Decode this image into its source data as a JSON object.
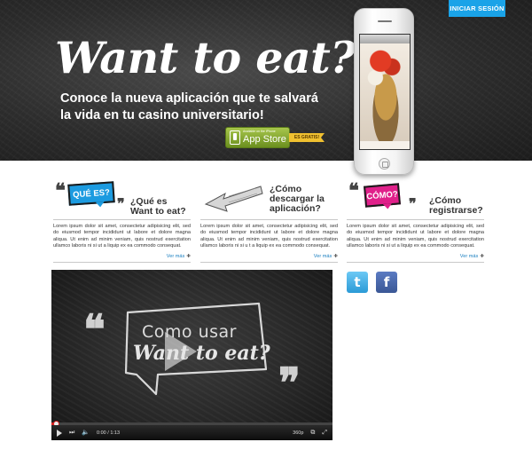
{
  "header": {
    "login_label": "INICIAR SESIÓN",
    "title": "Want to eat?",
    "subtitle": "Conoce la nueva aplicación que te salvará la vida en tu casino universitario!",
    "appstore": {
      "small_text": "Available on the iPhone",
      "big_text": "App Store"
    },
    "free_tag": "ES GRATIS!"
  },
  "features": [
    {
      "bubble": "QUÉ ES?",
      "title": "¿Qué es\nWant to eat?",
      "text": "Lorem ipsum dolor sit amet, consectetur adipisicing elit, sed do eiusmod tempor incididunt ut labore et dolore magna aliqua. Ut enim ad minim veniam, quis nostrud exercitation ullamco laboris ni si ut a liquip ex ea commodo consequat.",
      "more": "Ver más"
    },
    {
      "bubble": "",
      "title": "¿Cómo\ndescargar la\naplicación?",
      "text": "Lorem ipsum dolor sit amet, consectetur adipisicing elit, sed do eiusmod tempor incididunt ut labore et dolore magna aliqua. Ut enim ad minim veniam, quis nostrud exercitation ullamco laboris ni si u t a liquip ex ea commodo consequat.",
      "more": "Ver más"
    },
    {
      "bubble": "CÓMO?",
      "title": "¿Cómo\nregistrarse?",
      "text": "Lorem ipsum dolor sit amet, consectetur adipisicing elit, sed do eiusmod tempor incididunt ut labore et dolore magna aliqua. Ut enim ad minim veniam, quis nostrud exercitation ullamco laboris ni si ut a liquip ex ea commodo consequat.",
      "more": "Ver más"
    }
  ],
  "social": {
    "twitter_glyph": "t",
    "facebook_glyph": "f"
  },
  "video": {
    "line1": "Como usar",
    "line2": "Want to eat?",
    "time": "0:00 / 1:13",
    "quality": "360p",
    "progress": 0.02
  },
  "colors": {
    "accent_blue": "#1aa3e8",
    "bubble_blue": "#1c9be0",
    "bubble_pink": "#e0208a",
    "progress_red": "#d62020"
  }
}
